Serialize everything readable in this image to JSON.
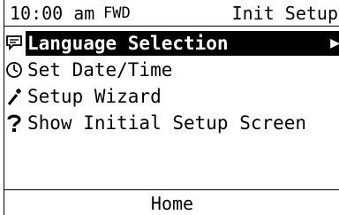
{
  "status": {
    "time": "10:00 am",
    "direction": "FWD",
    "mode": "Init Setup"
  },
  "menu": {
    "items": [
      {
        "label": "Language Selection",
        "icon": "speech-bubble-icon",
        "selected": true
      },
      {
        "label": "Set Date/Time",
        "icon": "clock-icon",
        "selected": false
      },
      {
        "label": "Setup Wizard",
        "icon": "magic-wand-icon",
        "selected": false
      },
      {
        "label": "Show Initial Setup Screen",
        "icon": "question-mark-icon",
        "selected": false
      }
    ],
    "selected_arrow": "▶"
  },
  "function_keys": {
    "center": "Home"
  },
  "colors": {
    "foreground": "#000000",
    "background": "#ffffff",
    "selection": "#000000"
  }
}
